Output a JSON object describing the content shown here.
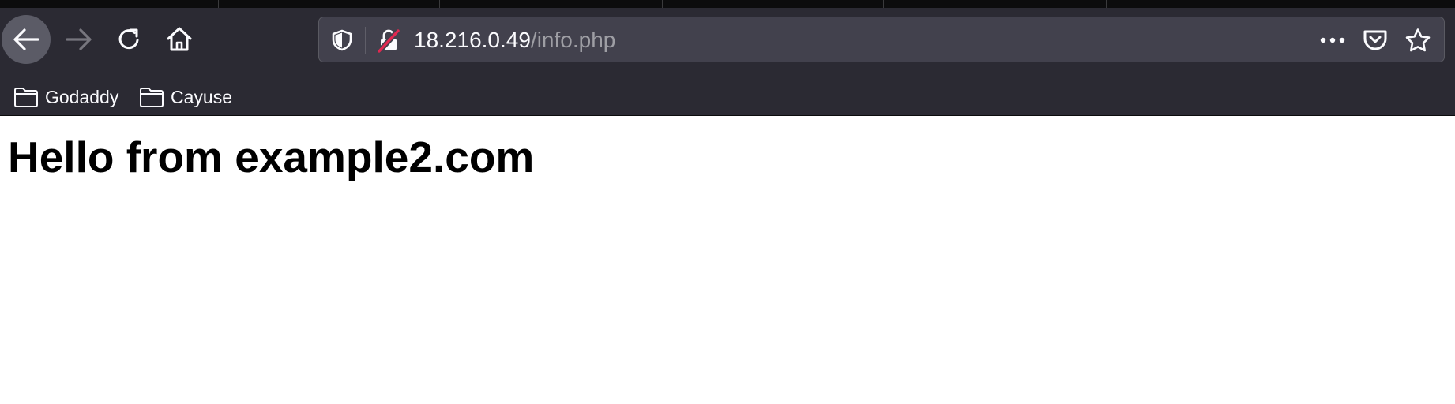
{
  "browser": {
    "url_host": "18.216.0.49",
    "url_path": "/info.php"
  },
  "icons": {
    "back": "arrow-left-icon",
    "forward": "arrow-right-icon",
    "reload": "reload-icon",
    "home": "home-icon",
    "tracking_protection": "shield-icon",
    "connection": "insecure-lock-icon",
    "page_actions": "more-horizontal-icon",
    "pocket": "pocket-icon",
    "bookmark_star": "star-icon",
    "folder": "folder-icon"
  },
  "bookmarks": [
    {
      "label": "Godaddy"
    },
    {
      "label": "Cayuse"
    }
  ],
  "page": {
    "heading": "Hello from example2.com"
  },
  "colors": {
    "toolbar_bg": "#2b2a33",
    "urlbar_bg": "#42414d",
    "insecure_accent": "#e22850",
    "page_bg": "#ffffff"
  }
}
